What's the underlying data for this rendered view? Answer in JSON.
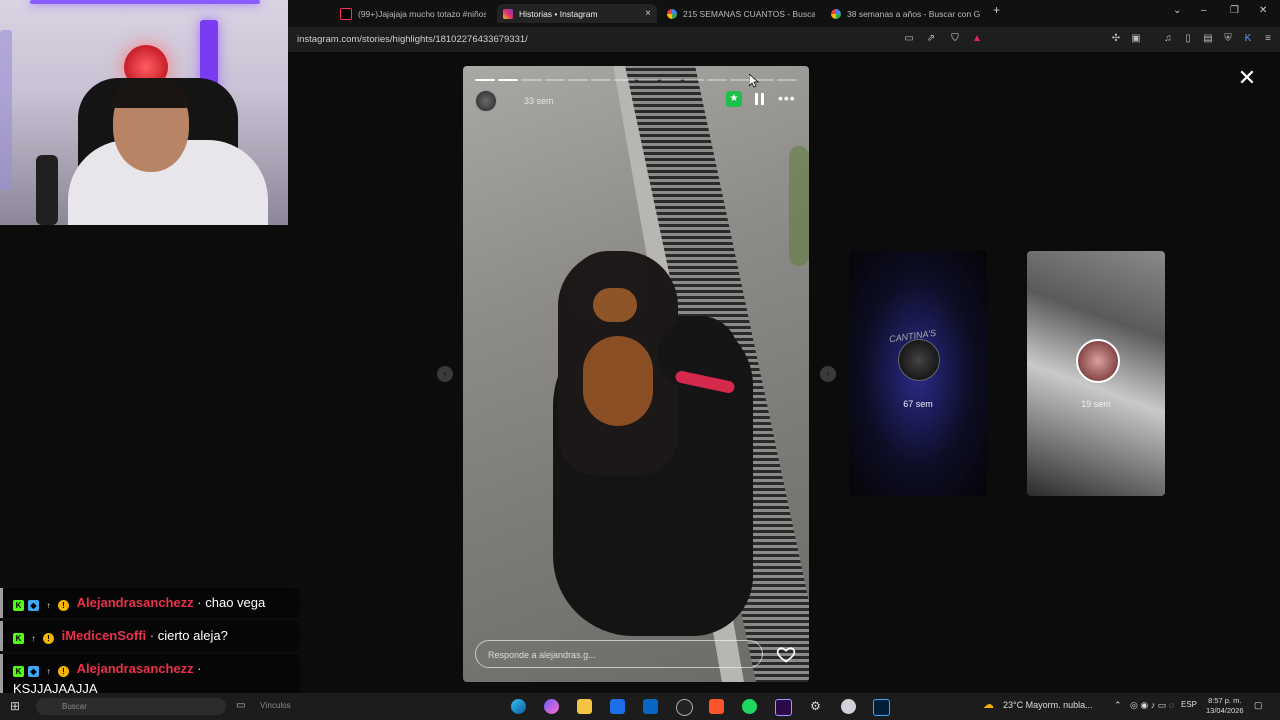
{
  "browser": {
    "tabs": [
      {
        "label": "(99+)Jajajaja mucho totazo #niños #",
        "icon": "tiktok-icon",
        "active": false
      },
      {
        "label": "Historias • Instagram",
        "icon": "instagram-icon",
        "active": true
      },
      {
        "label": "215 SEMANAS CUANTOS - Buscar co",
        "icon": "google-icon",
        "active": false
      },
      {
        "label": "38 semanas a años - Buscar con Goo",
        "icon": "google-icon",
        "active": false
      }
    ],
    "close_tab_glyph": "×",
    "new_tab_glyph": "+",
    "url": "instagram.com/stories/highlights/18102276433679331/"
  },
  "story": {
    "time": "33 sem",
    "reply_placeholder": "Responde a alejandras.g...",
    "progress_total": 14,
    "progress_done": 2,
    "star_glyph": "★",
    "more_glyph": "•••"
  },
  "previews": [
    {
      "label": "67 sem",
      "overlay_text": "CANTINA'S"
    },
    {
      "label": "19 sem"
    }
  ],
  "chat": [
    {
      "user": "Alejandrasanchezz",
      "text": "chao vega",
      "user_color": "#e8324a"
    },
    {
      "user": "iMedicenSoffi",
      "text": "cierto aleja?",
      "user_color": "#e8324a"
    },
    {
      "user": "Alejandrasanchezz",
      "text": "KSJJAJAAJJA",
      "user_color": "#e8324a"
    }
  ],
  "taskbar": {
    "search_placeholder": "Buscar",
    "links_label": "Vínculos",
    "weather": "23°C  Mayorm. nubla...",
    "language": "ESP",
    "time": "8:57 p. m.",
    "date": "13/04/2026"
  }
}
